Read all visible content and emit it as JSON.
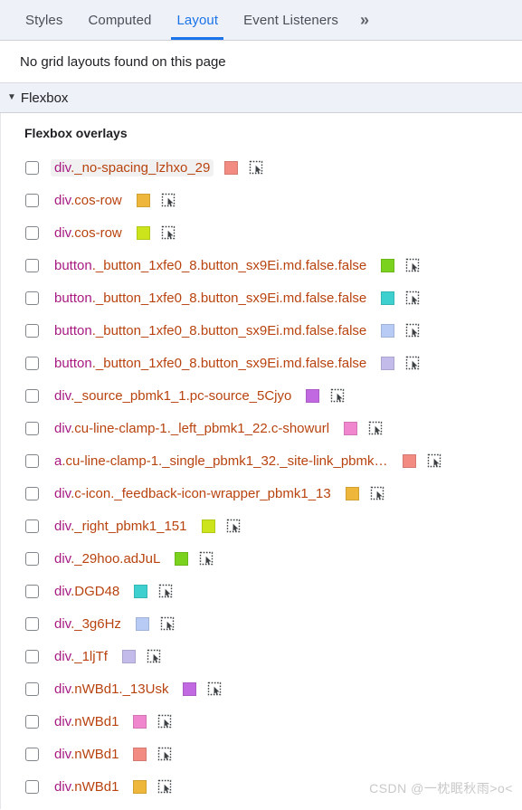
{
  "tabs": [
    {
      "label": "Styles",
      "active": false
    },
    {
      "label": "Computed",
      "active": false
    },
    {
      "label": "Layout",
      "active": true
    },
    {
      "label": "Event Listeners",
      "active": false
    }
  ],
  "tabs_overflow": {
    "label": "»",
    "icon": "chevron-double-right-icon"
  },
  "grid_section": {
    "empty_message": "No grid layouts found on this page"
  },
  "flexbox_section": {
    "caret": "▼",
    "title": "Flexbox",
    "overlays_heading": "Flexbox overlays",
    "overlays": [
      {
        "tag": "div",
        "classes": "._no-spacing_lzhxo_29",
        "color": "#f28b82",
        "checked": false,
        "hovered": true
      },
      {
        "tag": "div",
        "classes": ".cos-row",
        "color": "#eeb73b",
        "checked": false,
        "hovered": false
      },
      {
        "tag": "div",
        "classes": ".cos-row",
        "color": "#cbe41c",
        "checked": false,
        "hovered": false
      },
      {
        "tag": "button",
        "classes": "._button_1xfe0_8.button_sx9Ei.md.false.false",
        "color": "#7ad11e",
        "checked": false,
        "hovered": false
      },
      {
        "tag": "button",
        "classes": "._button_1xfe0_8.button_sx9Ei.md.false.false",
        "color": "#3ecfcf",
        "checked": false,
        "hovered": false
      },
      {
        "tag": "button",
        "classes": "._button_1xfe0_8.button_sx9Ei.md.false.false",
        "color": "#b8cbf5",
        "checked": false,
        "hovered": false
      },
      {
        "tag": "button",
        "classes": "._button_1xfe0_8.button_sx9Ei.md.false.false",
        "color": "#c3bcea",
        "checked": false,
        "hovered": false
      },
      {
        "tag": "div",
        "classes": "._source_pbmk1_1.pc-source_5Cjyo",
        "color": "#c069e0",
        "checked": false,
        "hovered": false
      },
      {
        "tag": "div",
        "classes": ".cu-line-clamp-1._left_pbmk1_22.c-showurl",
        "color": "#ef86ce",
        "checked": false,
        "hovered": false
      },
      {
        "tag": "a",
        "classes": ".cu-line-clamp-1._single_pbmk1_32._site-link_pbmk…",
        "color": "#f28b82",
        "checked": false,
        "hovered": false
      },
      {
        "tag": "div",
        "classes": ".c-icon._feedback-icon-wrapper_pbmk1_13",
        "color": "#eeb73b",
        "checked": false,
        "hovered": false
      },
      {
        "tag": "div",
        "classes": "._right_pbmk1_151",
        "color": "#cbe41c",
        "checked": false,
        "hovered": false
      },
      {
        "tag": "div",
        "classes": "._29hoo.adJuL",
        "color": "#7ad11e",
        "checked": false,
        "hovered": false
      },
      {
        "tag": "div",
        "classes": ".DGD48",
        "color": "#3ecfcf",
        "checked": false,
        "hovered": false
      },
      {
        "tag": "div",
        "classes": "._3g6Hz",
        "color": "#b8cbf5",
        "checked": false,
        "hovered": false
      },
      {
        "tag": "div",
        "classes": "._1ljTf",
        "color": "#c3bcea",
        "checked": false,
        "hovered": false
      },
      {
        "tag": "div",
        "classes": ".nWBd1._13Usk",
        "color": "#c069e0",
        "checked": false,
        "hovered": false
      },
      {
        "tag": "div",
        "classes": ".nWBd1",
        "color": "#ef86ce",
        "checked": false,
        "hovered": false
      },
      {
        "tag": "div",
        "classes": ".nWBd1",
        "color": "#f28b82",
        "checked": false,
        "hovered": false
      },
      {
        "tag": "div",
        "classes": ".nWBd1",
        "color": "#eeb73b",
        "checked": false,
        "hovered": false
      }
    ]
  },
  "watermark": "CSDN @一枕眠秋雨>o<",
  "theme": {
    "accent": "#1a73e8",
    "tabbar_bg": "#eff1f8",
    "tagname_color": "#a61a82",
    "classname_color": "#b8430f"
  }
}
